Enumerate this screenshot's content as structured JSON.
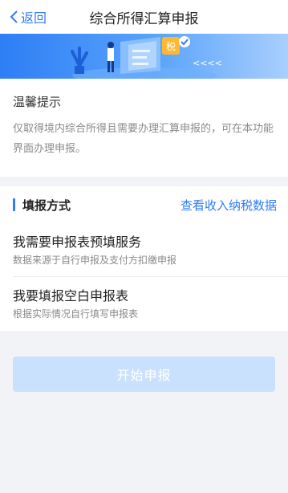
{
  "nav": {
    "back_label": "返回",
    "title": "综合所得汇算申报"
  },
  "banner": {
    "badge_text": "税",
    "arrows_text": "<<<<"
  },
  "notice": {
    "title": "温馨提示",
    "text": "仅取得境内综合所得且需要办理汇算申报的，可在本功能界面办理申报。"
  },
  "fill_method": {
    "title": "填报方式",
    "link_label": "查看收入纳税数据",
    "options": [
      {
        "title": "我需要申报表预填服务",
        "subtitle": "数据来源于自行申报及支付方扣缴申报"
      },
      {
        "title": "我要填报空白申报表",
        "subtitle": "根据实际情况自行填写申报表"
      }
    ]
  },
  "start_button": {
    "label": "开始申报"
  },
  "colors": {
    "accent": "#2f7cf6",
    "disabled_button": "#c9e1fd",
    "page_bg": "#f2f3f7"
  }
}
